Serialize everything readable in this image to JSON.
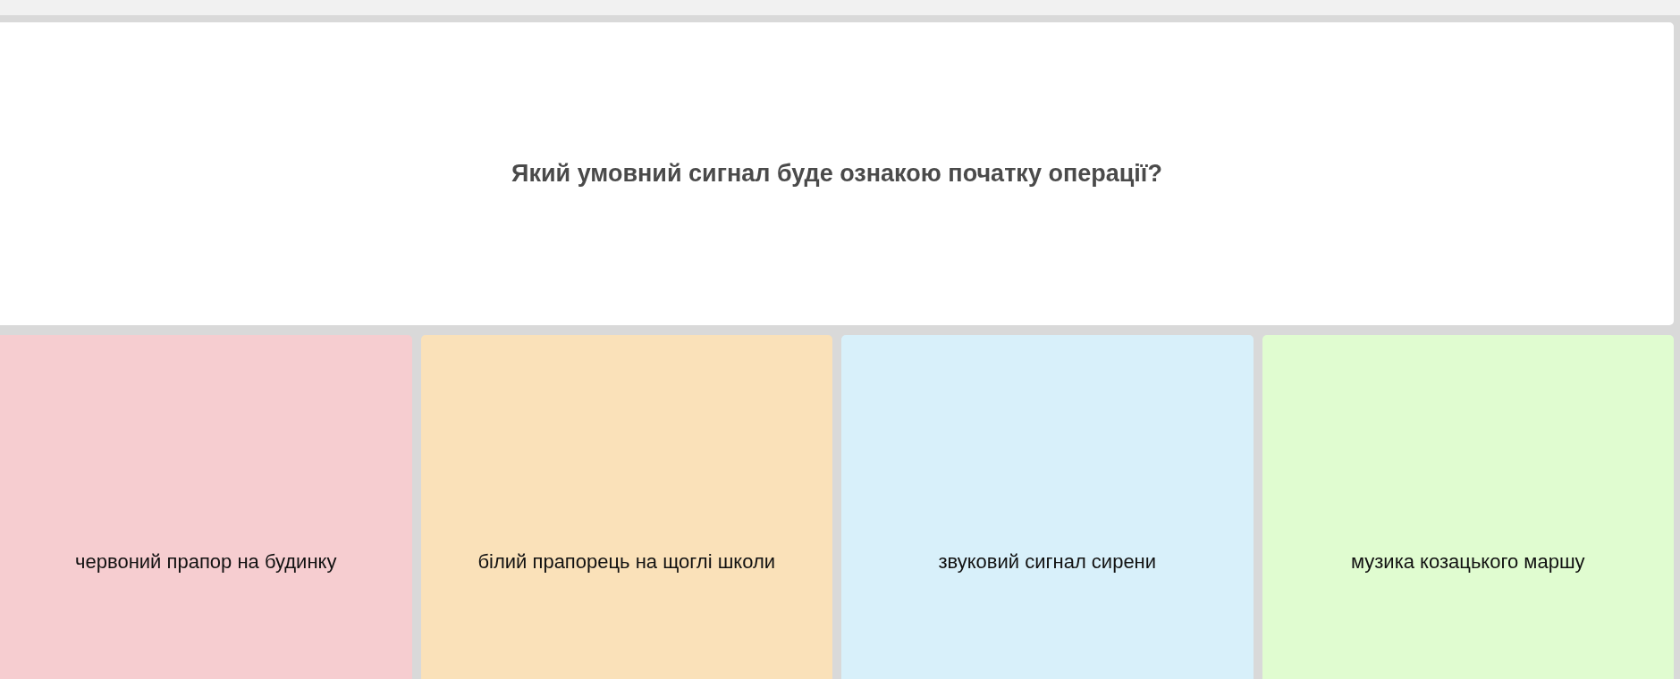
{
  "question": "Який умовний сигнал буде ознакою початку операції?",
  "answers": [
    {
      "text": "червоний прапор на будинку",
      "color": "#f6cdd0"
    },
    {
      "text": "білий прапорець на щоглі школи",
      "color": "#fae1b9"
    },
    {
      "text": "звуковий сигнал сирени",
      "color": "#d8f0fa"
    },
    {
      "text": "музика козацького маршу",
      "color": "#e0fcd0"
    }
  ]
}
